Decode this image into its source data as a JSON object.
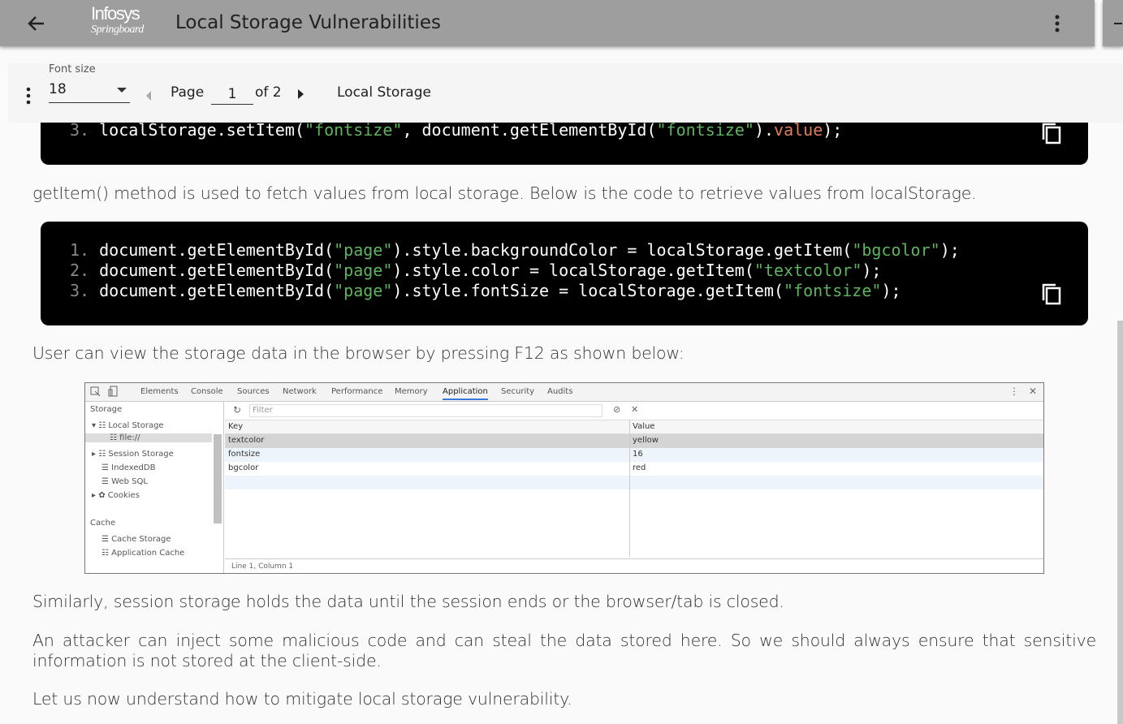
{
  "header": {
    "title": "Local Storage Vulnerabilities",
    "logo_line1": "Infosys",
    "logo_line2": "Springboard"
  },
  "toolbar": {
    "font_size_label": "Font size",
    "font_size_value": "18",
    "page_label": "Page",
    "page_value": "1",
    "page_of": "of 2",
    "section": "Local Storage"
  },
  "content": {
    "code1": {
      "line3_num": "3.",
      "line3": [
        "localStorage.setItem(",
        "\"fontsize\"",
        ", document.getElementById(",
        "\"fontsize\"",
        ").",
        "value",
        ");"
      ]
    },
    "para1": "getItem() method is used to fetch values from local storage. Below is the code to retrieve values from localStorage.",
    "code2": [
      {
        "num": "1.",
        "a": "document.getElementById(",
        "s1": "\"page\"",
        "b": ").style.backgroundColor = localStorage.getItem(",
        "s2": "\"bgcolor\"",
        "c": ");"
      },
      {
        "num": "2.",
        "a": "document.getElementById(",
        "s1": "\"page\"",
        "b": ").style.color = localStorage.getItem(",
        "s2": "\"textcolor\"",
        "c": ");"
      },
      {
        "num": "3.",
        "a": "document.getElementById(",
        "s1": "\"page\"",
        "b": ").style.fontSize = localStorage.getItem(",
        "s2": "\"fontsize\"",
        "c": ");"
      }
    ],
    "para2": "User can view the storage data in the browser by pressing F12 as shown below:",
    "para3": "Similarly, session storage holds the data until the session ends or the browser/tab is closed.",
    "para4": "An attacker can inject some malicious code and can steal the data stored here. So we should always ensure that sensitive information is not stored at the client-side.",
    "para5": "Let us now understand how to mitigate local storage vulnerability."
  },
  "devtools": {
    "tabs": [
      "Elements",
      "Console",
      "Sources",
      "Network",
      "Performance",
      "Memory",
      "Application",
      "Security",
      "Audits"
    ],
    "active_tab": "Application",
    "sidebar": {
      "storage_heading": "Storage",
      "local_storage": "Local Storage",
      "file": "file://",
      "session_storage": "Session Storage",
      "indexeddb": "IndexedDB",
      "websql": "Web SQL",
      "cookies": "Cookies",
      "cache_heading": "Cache",
      "cache_storage": "Cache Storage",
      "app_cache": "Application Cache"
    },
    "filter_placeholder": "Filter",
    "columns": [
      "Key",
      "Value"
    ],
    "rows": [
      {
        "key": "textcolor",
        "value": "yellow"
      },
      {
        "key": "fontsize",
        "value": "16"
      },
      {
        "key": "bgcolor",
        "value": "red"
      }
    ],
    "status": "Line 1, Column 1"
  },
  "colors": {
    "appbar": "#9e9e9e",
    "code_bg": "#000000",
    "string": "#5fb35f",
    "property": "#e07d58",
    "tab_active": "#3879d9"
  }
}
